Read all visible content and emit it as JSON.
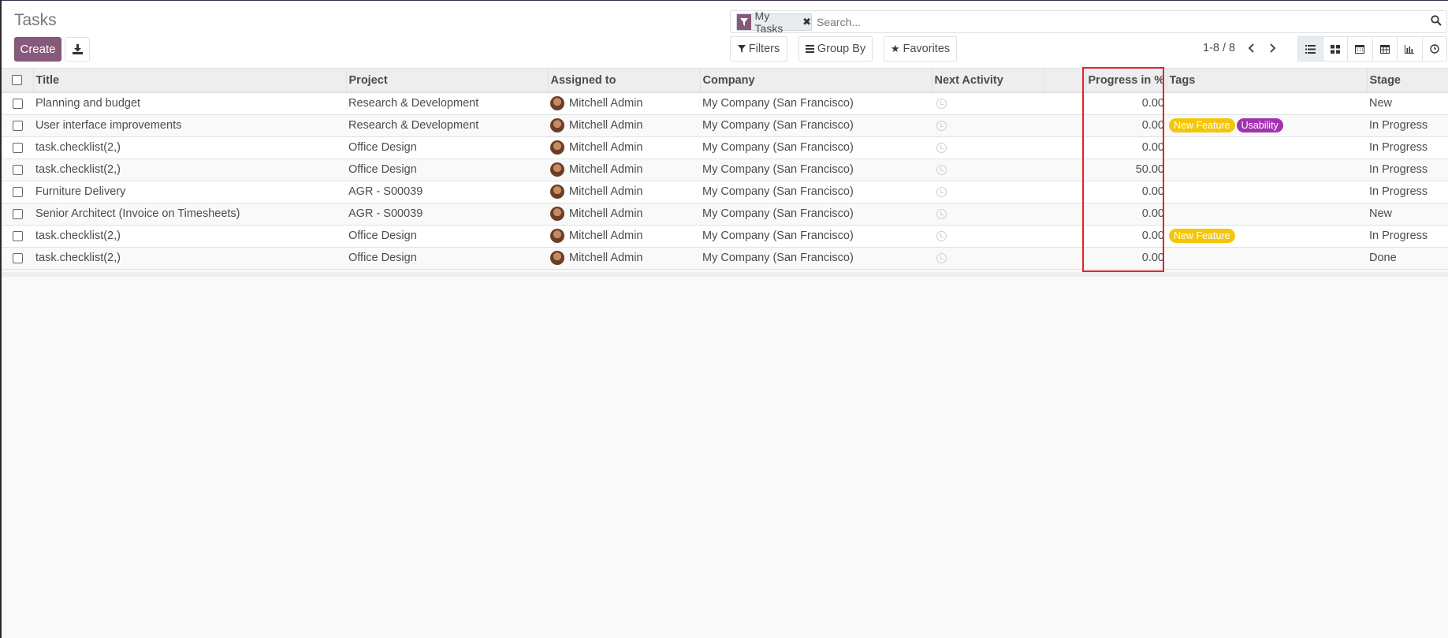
{
  "page": {
    "title": "Tasks"
  },
  "toolbar": {
    "create_label": "Create",
    "filters_label": "Filters",
    "groupby_label": "Group By",
    "favorites_label": "Favorites"
  },
  "search": {
    "facet_label": "My Tasks",
    "placeholder": "Search..."
  },
  "pager": {
    "value": "1-8 / 8"
  },
  "views": [
    "list",
    "kanban",
    "calendar",
    "pivot",
    "graph",
    "activity"
  ],
  "table": {
    "columns": {
      "title": "Title",
      "project": "Project",
      "assigned": "Assigned to",
      "company": "Company",
      "next_activity": "Next Activity",
      "progress": "Progress in %",
      "tags": "Tags",
      "stage": "Stage"
    },
    "rows": [
      {
        "title": "Planning and budget",
        "project": "Research & Development",
        "assigned": "Mitchell Admin",
        "company": "My Company (San Francisco)",
        "progress": "0.00",
        "tags": [],
        "stage": "New"
      },
      {
        "title": "User interface improvements",
        "project": "Research & Development",
        "assigned": "Mitchell Admin",
        "company": "My Company (San Francisco)",
        "progress": "0.00",
        "tags": [
          "New Feature",
          "Usability"
        ],
        "stage": "In Progress"
      },
      {
        "title": "task.checklist(2,)",
        "project": "Office Design",
        "assigned": "Mitchell Admin",
        "company": "My Company (San Francisco)",
        "progress": "0.00",
        "tags": [],
        "stage": "In Progress"
      },
      {
        "title": "task.checklist(2,)",
        "project": "Office Design",
        "assigned": "Mitchell Admin",
        "company": "My Company (San Francisco)",
        "progress": "50.00",
        "tags": [],
        "stage": "In Progress"
      },
      {
        "title": "Furniture Delivery",
        "project": "AGR - S00039",
        "assigned": "Mitchell Admin",
        "company": "My Company (San Francisco)",
        "progress": "0.00",
        "tags": [],
        "stage": "In Progress"
      },
      {
        "title": "Senior Architect (Invoice on Timesheets)",
        "project": "AGR - S00039",
        "assigned": "Mitchell Admin",
        "company": "My Company (San Francisco)",
        "progress": "0.00",
        "tags": [],
        "stage": "New"
      },
      {
        "title": "task.checklist(2,)",
        "project": "Office Design",
        "assigned": "Mitchell Admin",
        "company": "My Company (San Francisco)",
        "progress": "0.00",
        "tags": [
          "New Feature"
        ],
        "stage": "In Progress"
      },
      {
        "title": "task.checklist(2,)",
        "project": "Office Design",
        "assigned": "Mitchell Admin",
        "company": "My Company (San Francisco)",
        "progress": "0.00",
        "tags": [],
        "stage": "Done"
      }
    ]
  },
  "colors": {
    "primary": "#875a7b",
    "tag_new_feature": "#f4c609",
    "tag_usability": "#a232b0",
    "highlight": "#e2242a"
  }
}
